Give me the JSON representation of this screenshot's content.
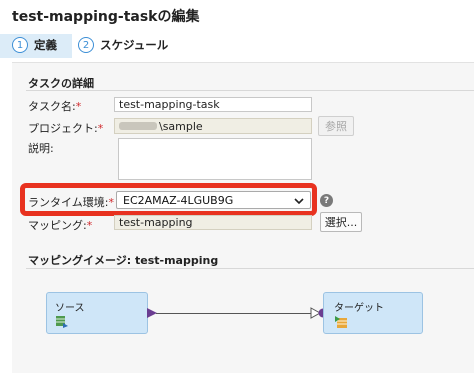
{
  "header": {
    "title": "test-mapping-taskの編集"
  },
  "steps": [
    {
      "num": "1",
      "label": "定義",
      "active": true
    },
    {
      "num": "2",
      "label": "スケジュール",
      "active": false
    }
  ],
  "task_details": {
    "section_title": "タスクの詳細",
    "task_name_label": "タスク名:",
    "task_name_value": "test-mapping-task",
    "project_label": "プロジェクト:",
    "project_value": "\\sample",
    "browse_label": "参照",
    "description_label": "説明:",
    "description_value": "",
    "runtime_label": "ランタイム環境:",
    "runtime_value": "EC2AMAZ-4LGUB9G",
    "help_glyph": "?",
    "mapping_label": "マッピング:",
    "mapping_value": "test-mapping",
    "select_label": "選択...",
    "required_mark": "*"
  },
  "mapping_image": {
    "title": "マッピングイメージ:  test-mapping",
    "source_label": "ソース",
    "target_label": "ターゲット"
  },
  "colors": {
    "highlight": "#e8321f",
    "active_step_bg": "#dcecf8",
    "node_fill": "#cfe6f8",
    "connector": "#6a3d91"
  },
  "icons": [
    "source-table-icon",
    "target-table-icon",
    "help-icon",
    "chevron-down-icon"
  ]
}
